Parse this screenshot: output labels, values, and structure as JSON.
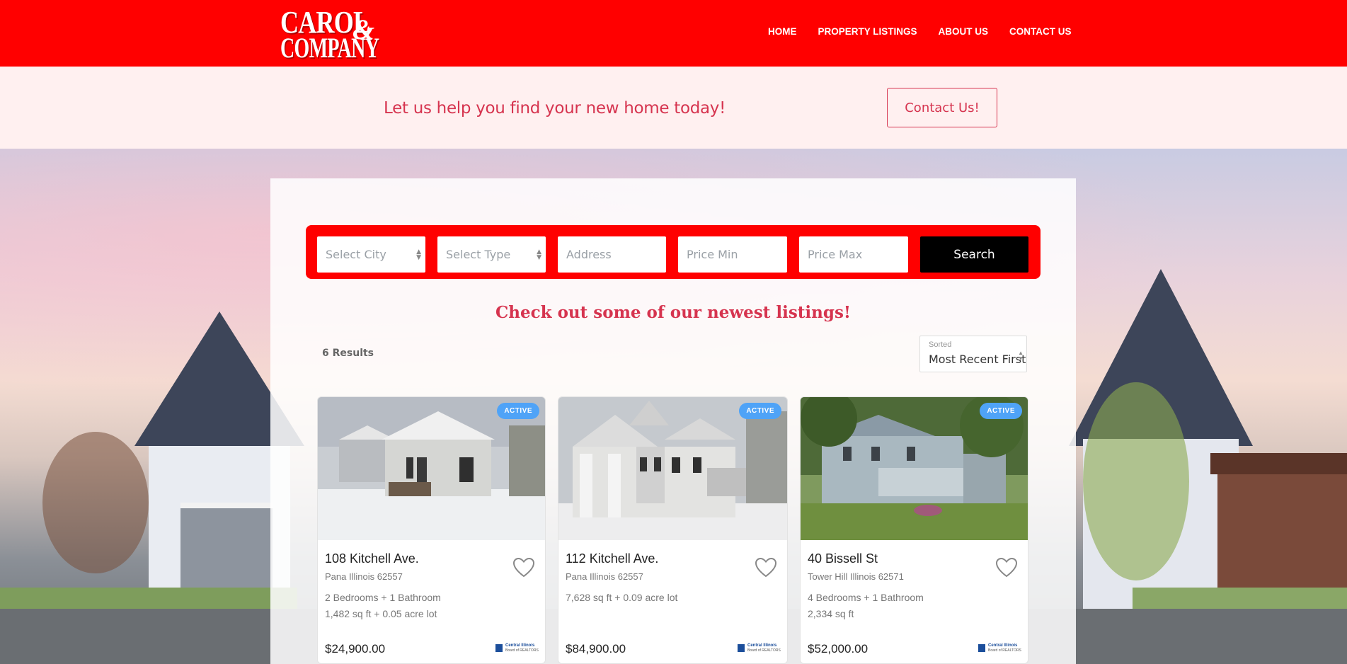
{
  "brand": {
    "logo_line1": "CAROL",
    "logo_amp": "&",
    "logo_line2": "COMPANY",
    "header_color": "#ff0000",
    "accent_color": "#d6344f"
  },
  "nav": {
    "items": [
      {
        "label": "HOME"
      },
      {
        "label": "PROPERTY LISTINGS"
      },
      {
        "label": "ABOUT US"
      },
      {
        "label": "CONTACT US"
      }
    ]
  },
  "banner": {
    "text": "Let us help you find your new home today!",
    "button_label": "Contact Us!"
  },
  "search": {
    "city_placeholder": "Select City",
    "type_placeholder": "Select Type",
    "address_placeholder": "Address",
    "price_min_placeholder": "Price Min",
    "price_max_placeholder": "Price Max",
    "button_label": "Search"
  },
  "listings_section": {
    "heading": "Check out some of our newest listings!",
    "results_count": "6 Results",
    "sort_label": "Sorted",
    "sort_value": "Most Recent First"
  },
  "listings": [
    {
      "status": "ACTIVE",
      "address": "108 Kitchell Ave.",
      "city": "Pana Illinois 62557",
      "line1": "2 Bedrooms + 1 Bathroom",
      "line2": "1,482 sq ft + 0.05 acre lot",
      "price": "$24,900.00",
      "mls_line1": "Central Illinois",
      "mls_line2": "Board of REALTORS"
    },
    {
      "status": "ACTIVE",
      "address": "112 Kitchell Ave.",
      "city": "Pana Illinois 62557",
      "line1": "7,628 sq ft + 0.09 acre lot",
      "line2": "",
      "price": "$84,900.00",
      "mls_line1": "Central Illinois",
      "mls_line2": "Board of REALTORS"
    },
    {
      "status": "ACTIVE",
      "address": "40 Bissell St",
      "city": "Tower Hill Illinois 62571",
      "line1": "4 Bedrooms + 1 Bathroom",
      "line2": "2,334 sq ft",
      "price": "$52,000.00",
      "mls_line1": "Central Illinois",
      "mls_line2": "Board of REALTORS"
    }
  ]
}
